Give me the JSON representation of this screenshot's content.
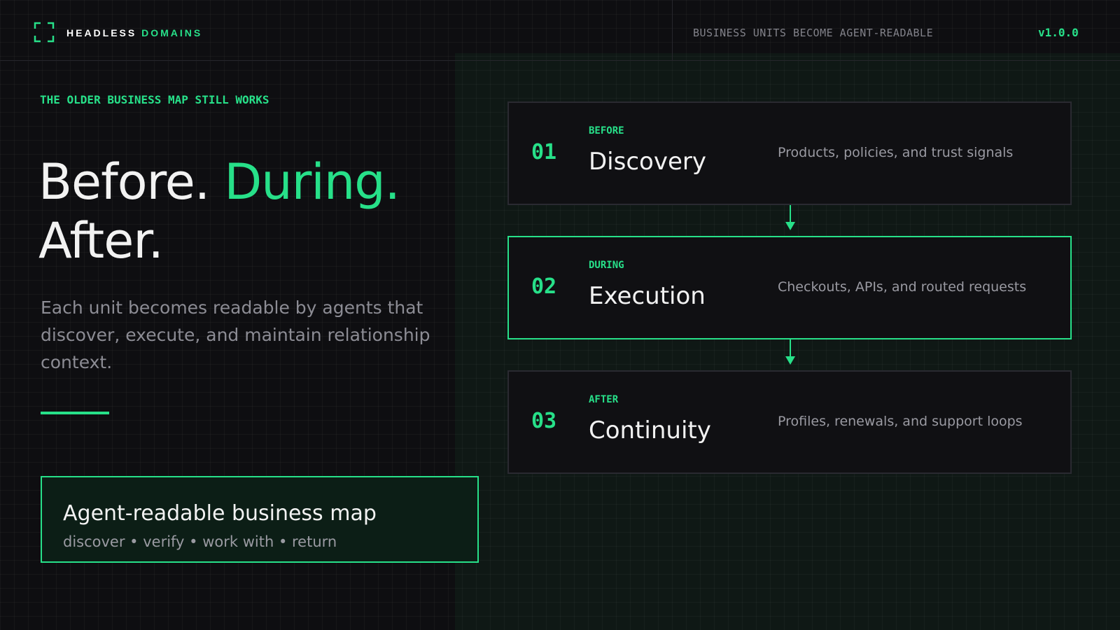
{
  "header": {
    "brand_primary": "HEADLESS",
    "brand_accent": "DOMAINS",
    "tagline": "BUSINESS UNITS BECOME AGENT-READABLE",
    "version": "v1.0.0"
  },
  "hero": {
    "eyebrow": "THE OLDER BUSINESS MAP STILL WORKS",
    "headline_before": "Before.",
    "headline_during": "During.",
    "headline_after": "After.",
    "description": "Each unit becomes readable by agents that discover, execute, and maintain relationship context."
  },
  "map_box": {
    "title": "Agent-readable business map",
    "subtitle": "discover • verify • work with • return"
  },
  "phases": [
    {
      "number": "01",
      "tag": "BEFORE",
      "title": "Discovery",
      "description": "Products, policies, and trust signals",
      "highlighted": false
    },
    {
      "number": "02",
      "tag": "DURING",
      "title": "Execution",
      "description": "Checkouts, APIs, and routed requests",
      "highlighted": true
    },
    {
      "number": "03",
      "tag": "AFTER",
      "title": "Continuity",
      "description": "Profiles, renewals, and support loops",
      "highlighted": false
    }
  ],
  "colors": {
    "accent": "#27e089",
    "background": "#0e0e11",
    "card_border": "#2a2a31"
  },
  "icons": {
    "logo": "bracket-frame-icon",
    "flow_arrow": "arrow-down-icon"
  }
}
